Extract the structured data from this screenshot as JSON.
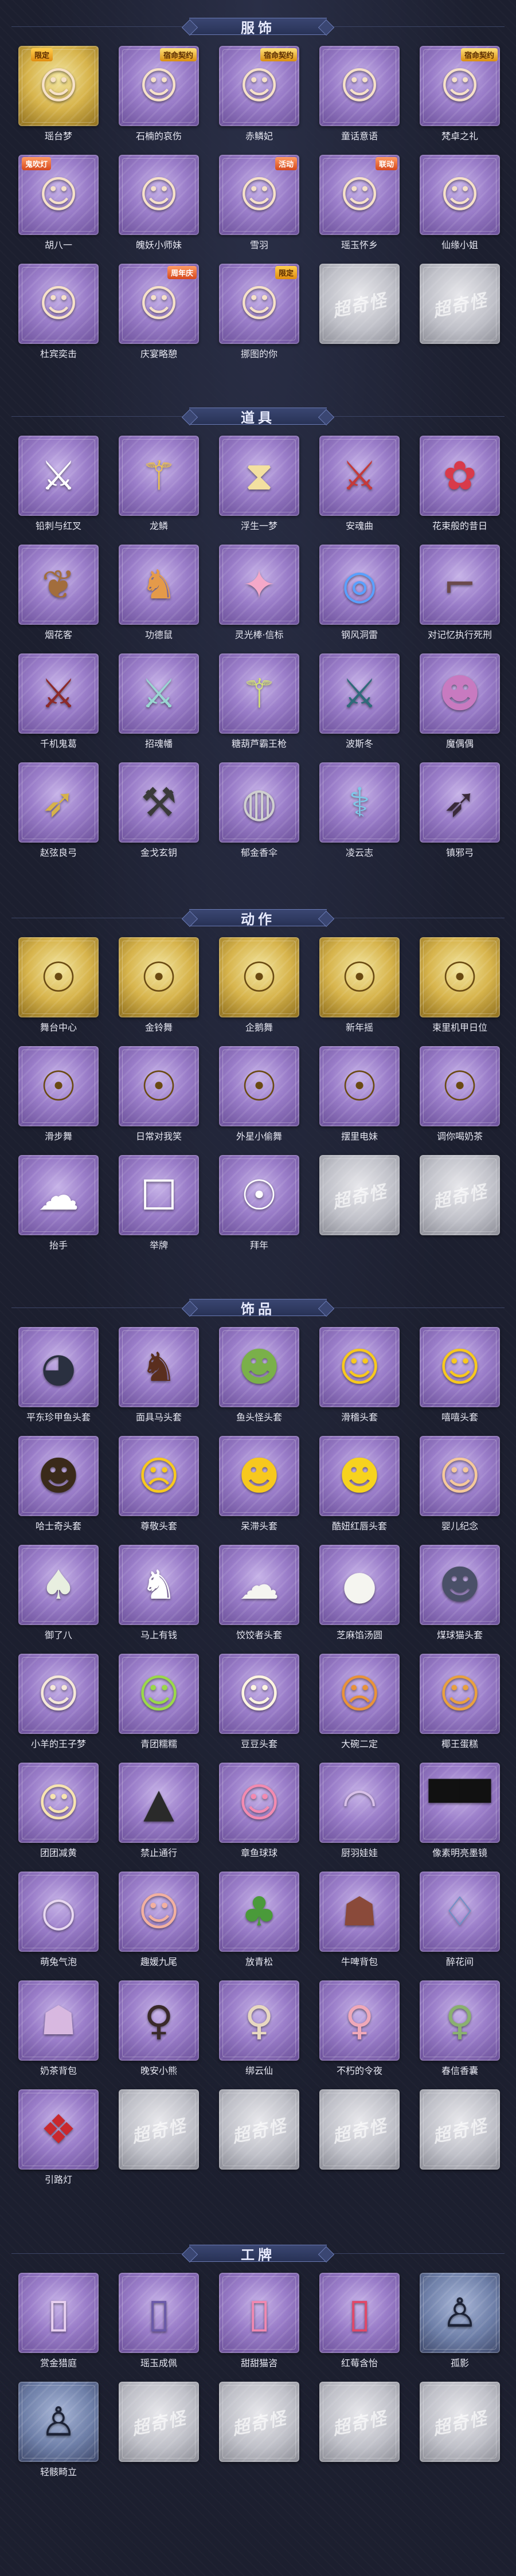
{
  "placeholder_logo": "超奇怪",
  "sections": [
    {
      "title": "服饰",
      "items": [
        {
          "name": "瑶台梦",
          "badge": "限定"
        },
        {
          "name": "石楠的哀伤",
          "badge": "宿命契约"
        },
        {
          "name": "赤鳞妃",
          "badge": "宿命契约"
        },
        {
          "name": "童话意语"
        },
        {
          "name": "梵卓之礼",
          "badge": "宿命契约"
        },
        {
          "name": "胡八一",
          "badge": "鬼吹灯"
        },
        {
          "name": "魄妖小师妹"
        },
        {
          "name": "雪羽",
          "badge": "活动"
        },
        {
          "name": "瑶玉怀乡",
          "badge": "联动"
        },
        {
          "name": "仙缘小姐"
        },
        {
          "name": "杜宾奕击"
        },
        {
          "name": "庆宴略憩",
          "badge": "周年庆"
        },
        {
          "name": "挪图的你",
          "badge": "限定"
        }
      ]
    },
    {
      "title": "道具",
      "items": [
        {
          "name": "铅刺与红叉"
        },
        {
          "name": "龙鳞"
        },
        {
          "name": "浮生一梦"
        },
        {
          "name": "安魂曲"
        },
        {
          "name": "花束般的昔日"
        },
        {
          "name": "烟花客"
        },
        {
          "name": "功德鼠"
        },
        {
          "name": "灵光棒·信标"
        },
        {
          "name": "钢风洞雷"
        },
        {
          "name": "对记忆执行死刑"
        },
        {
          "name": "千机鬼葛"
        },
        {
          "name": "招魂幡"
        },
        {
          "name": "糖葫芦霸王枪"
        },
        {
          "name": "波斯冬"
        },
        {
          "name": "魔偶偶"
        },
        {
          "name": "赵弦良弓"
        },
        {
          "name": "金戈玄钥"
        },
        {
          "name": "郁金香伞"
        },
        {
          "name": "凌云志"
        },
        {
          "name": "镇邪弓"
        }
      ]
    },
    {
      "title": "动作",
      "items": [
        {
          "name": "舞台中心"
        },
        {
          "name": "金铃舞"
        },
        {
          "name": "企鹅舞"
        },
        {
          "name": "新年摇"
        },
        {
          "name": "束里机甲日位"
        },
        {
          "name": "滑步舞"
        },
        {
          "name": "日常对我笑"
        },
        {
          "name": "外星小偷舞"
        },
        {
          "name": "摆里电妹"
        },
        {
          "name": "调你喝奶茶"
        },
        {
          "name": "抬手"
        },
        {
          "name": "举牌"
        },
        {
          "name": "拜年"
        }
      ]
    },
    {
      "title": "饰品",
      "items": [
        {
          "name": "平东珍甲鱼头套"
        },
        {
          "name": "面具马头套"
        },
        {
          "name": "鱼头怪头套"
        },
        {
          "name": "滑稽头套"
        },
        {
          "name": "嘻嘻头套"
        },
        {
          "name": "哈士奇头套"
        },
        {
          "name": "尊敬头套"
        },
        {
          "name": "呆滞头套"
        },
        {
          "name": "酷妞红唇头套"
        },
        {
          "name": "婴儿纪念"
        },
        {
          "name": "御了八"
        },
        {
          "name": "马上有钱"
        },
        {
          "name": "饺饺者头套"
        },
        {
          "name": "芝麻馅汤圆"
        },
        {
          "name": "煤球猫头套"
        },
        {
          "name": "小羊的王子梦"
        },
        {
          "name": "青团糯糯"
        },
        {
          "name": "豆豆头套"
        },
        {
          "name": "大碗二定"
        },
        {
          "name": "椰王蛋糕"
        },
        {
          "name": "团团减黄"
        },
        {
          "name": "禁止通行"
        },
        {
          "name": "章鱼球球"
        },
        {
          "name": "厨羽娃娃"
        },
        {
          "name": "像素明亮墨镜"
        },
        {
          "name": "萌兔气泡"
        },
        {
          "name": "趣媛九尾"
        },
        {
          "name": "放青松"
        },
        {
          "name": "牛啤背包"
        },
        {
          "name": "醉花间"
        },
        {
          "name": "奶茶背包"
        },
        {
          "name": "晚安小熊"
        },
        {
          "name": "绑云仙"
        },
        {
          "name": "不朽的令夜"
        },
        {
          "name": "春信香囊"
        },
        {
          "name": "引路灯"
        }
      ]
    },
    {
      "title": "工牌",
      "items": [
        {
          "name": "赏金猎庭"
        },
        {
          "name": "瑶玉成佩"
        },
        {
          "name": "甜甜猫咨"
        },
        {
          "name": "红莓含怡"
        },
        {
          "name": "孤影"
        },
        {
          "name": "轻骸畸立"
        }
      ]
    }
  ]
}
